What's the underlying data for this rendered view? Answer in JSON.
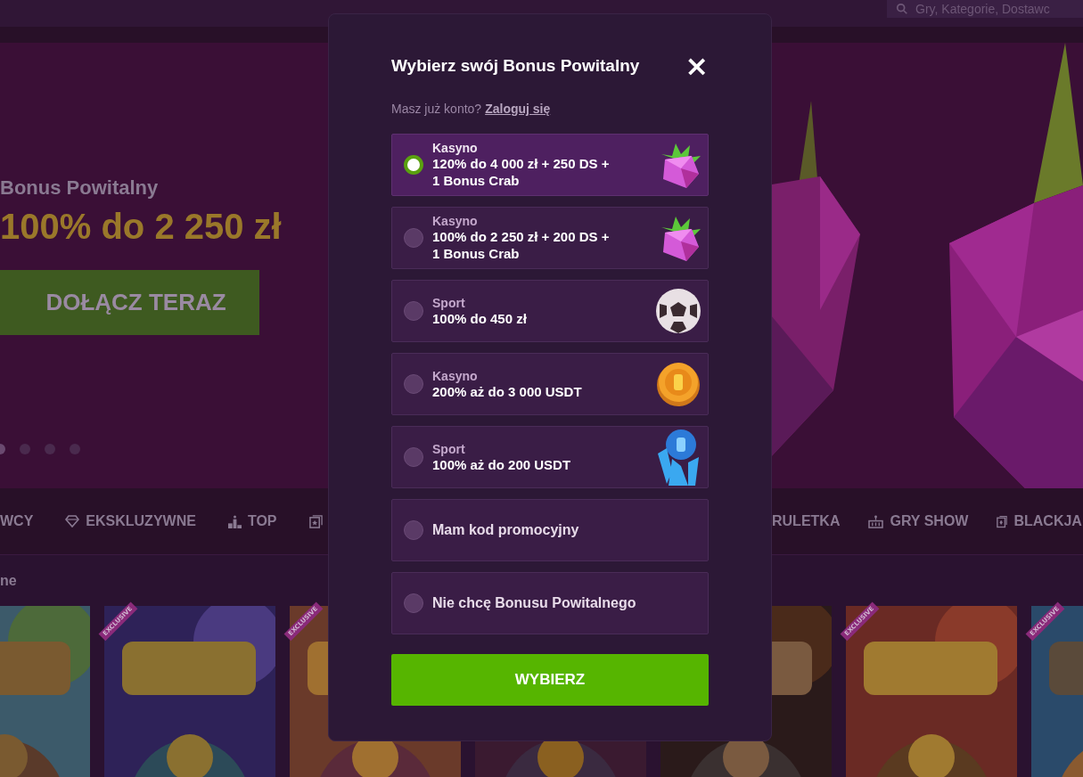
{
  "header": {
    "search": {
      "placeholder": "Gry, Kategorie, Dostawc"
    }
  },
  "hero": {
    "subtitle": "Bonus Powitalny",
    "amount": "100% do 2 250 zł",
    "cta": "DOŁĄCZ TERAZ",
    "slides": [
      {
        "selected": true
      },
      {
        "selected": false
      },
      {
        "selected": false
      },
      {
        "selected": false
      }
    ]
  },
  "categories_left": [
    {
      "kind": "tab",
      "label": "WCY"
    },
    {
      "kind": "tab",
      "label": "EKSKLUZYWNE"
    },
    {
      "kind": "tab",
      "label": "TOP"
    },
    {
      "kind": "icon"
    }
  ],
  "categories_right": [
    {
      "label": "RULETKA"
    },
    {
      "label": "GRY SHOW"
    },
    {
      "label": "BLACKJA"
    }
  ],
  "section_title": "ne",
  "games": [
    {
      "kind": "picture"
    },
    {
      "kind": "picture",
      "badge": "EXCLUSIVE"
    },
    {
      "kind": "picture",
      "badge": "EXCLUSIVE"
    },
    {
      "kind": "picture"
    },
    {
      "kind": "picture"
    },
    {
      "kind": "picture",
      "badge": "EXCLUSIVE"
    },
    {
      "kind": "picture",
      "badge": "EXCLUSIVE"
    }
  ],
  "modal": {
    "title": "Wybierz swój Bonus Powitalny",
    "close": "×",
    "prompt": "Masz już konto?",
    "login_link": "Zaloguj się",
    "options": [
      {
        "kind": "bonus",
        "category": "Kasyno",
        "offer": "120% do 4 000 zł + 250 DS + 1 Bonus Crab",
        "selected": true
      },
      {
        "kind": "bonus",
        "category": "Kasyno",
        "offer": "100% do 2 250 zł + 200 DS + 1 Bonus Crab",
        "selected": false
      },
      {
        "kind": "bonus",
        "category": "Sport",
        "offer": "100% do 450 zł",
        "selected": false
      },
      {
        "kind": "bonus",
        "category": "Kasyno",
        "offer": "200% aż do 3 000 USDT",
        "selected": false
      },
      {
        "kind": "bonus",
        "category": "Sport",
        "offer": "100% aż do 200 USDT",
        "selected": false
      },
      {
        "kind": "plain",
        "offer": "Mam kod promocyjny",
        "selected": false
      },
      {
        "kind": "plain",
        "offer": "Nie chcę Bonusu Powitalnego",
        "selected": false
      }
    ],
    "submit": "WYBIERZ"
  }
}
